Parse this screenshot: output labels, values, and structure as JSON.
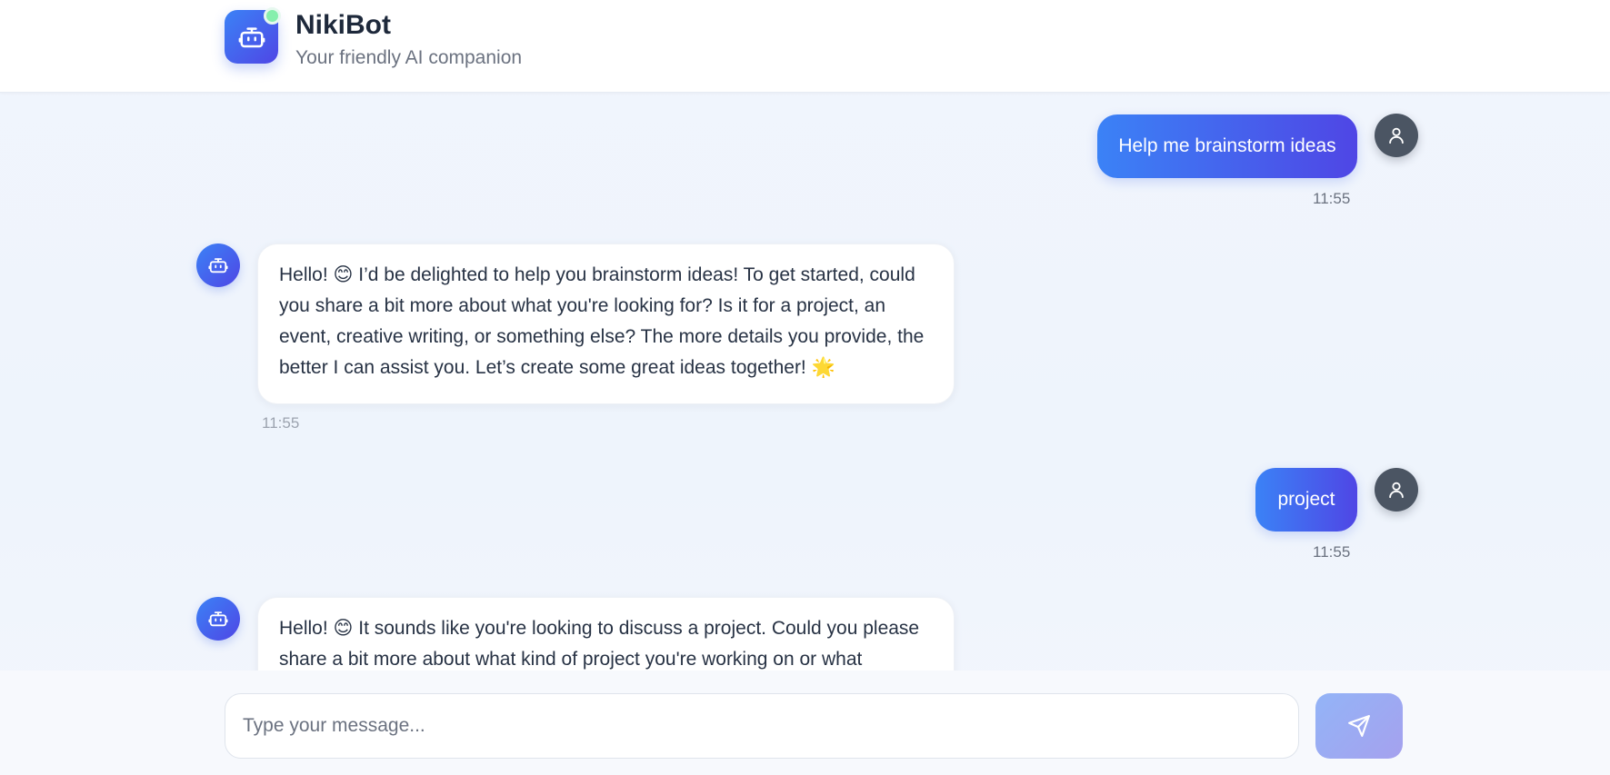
{
  "header": {
    "title": "NikiBot",
    "subtitle": "Your friendly AI companion",
    "logo_icon": "robot-icon",
    "status": "online",
    "status_color": "#86efac"
  },
  "messages": [
    {
      "sender": "user",
      "text": "Help me brainstorm ideas",
      "time": "11:55"
    },
    {
      "sender": "bot",
      "text": "Hello! 😊 I’d be delighted to help you brainstorm ideas! To get started, could you share a bit more about what you're looking for? Is it for a project, an event, creative writing, or something else? The more details you provide, the better I can assist you. Let’s create some great ideas together! 🌟",
      "time": "11:55"
    },
    {
      "sender": "user",
      "text": "project",
      "time": "11:55"
    },
    {
      "sender": "bot",
      "text": "Hello! 😊 It sounds like you're looking to discuss a project. Could you please share a bit more about what kind of project you're working on or what"
    }
  ],
  "composer": {
    "placeholder": "Type your message...",
    "value": "",
    "send_icon": "send-icon"
  },
  "colors": {
    "accent_start": "#3b82f6",
    "accent_end": "#4f46e5",
    "user_avatar": "#4b5563",
    "background": "#eef3fb"
  }
}
